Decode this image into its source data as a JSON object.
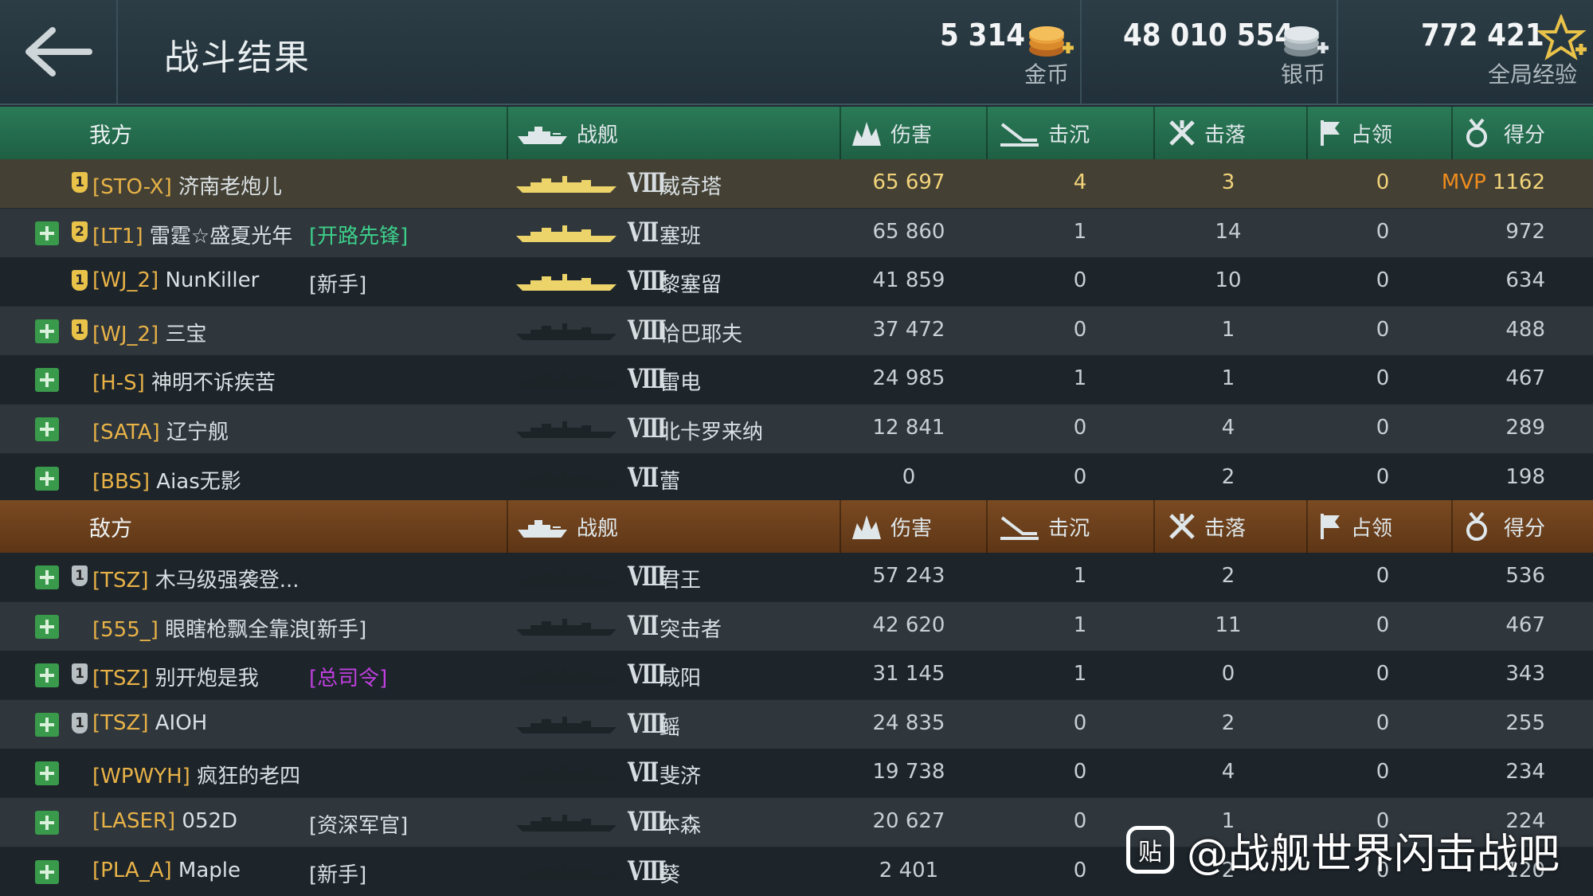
{
  "header": {
    "title": "战斗结果",
    "gold": {
      "amount": "5 314",
      "label": "金币"
    },
    "silver": {
      "amount": "48 010 554",
      "label": "银币"
    },
    "xp": {
      "amount": "772 421",
      "label": "全局经验"
    }
  },
  "columns": {
    "ship": "战舰",
    "damage": "伤害",
    "sunk": "击沉",
    "downed": "击落",
    "captured": "占领",
    "score": "得分"
  },
  "allies": {
    "label": "我方",
    "rows": [
      {
        "badge": "1",
        "clan": "[STO-X]",
        "name": "济南老炮儿",
        "title": "",
        "tier": "VIII",
        "ship": "威奇塔",
        "damage": "65 697",
        "sunk": "4",
        "downed": "3",
        "captured": "0",
        "mvp": "MVP",
        "score": "1162"
      },
      {
        "badge": "2",
        "clan": "[LT1]",
        "name": "雷霆☆盛夏光年",
        "title": "[开路先锋]",
        "tier": "VII",
        "ship": "塞班",
        "damage": "65 860",
        "sunk": "1",
        "downed": "14",
        "captured": "0",
        "mvp": "",
        "score": "972"
      },
      {
        "badge": "1",
        "clan": "[WJ_2]",
        "name": "NunKiller",
        "title": "[新手]",
        "tier": "VIII",
        "ship": "黎塞留",
        "damage": "41 859",
        "sunk": "0",
        "downed": "10",
        "captured": "0",
        "mvp": "",
        "score": "634"
      },
      {
        "badge": "1",
        "clan": "[WJ_2]",
        "name": "三宝",
        "title": "",
        "tier": "VIII",
        "ship": "恰巴耶夫",
        "damage": "37 472",
        "sunk": "0",
        "downed": "1",
        "captured": "0",
        "mvp": "",
        "score": "488"
      },
      {
        "badge": "",
        "clan": "[H-S]",
        "name": "神明不诉疾苦",
        "title": "",
        "tier": "VIII",
        "ship": "雷电",
        "damage": "24 985",
        "sunk": "1",
        "downed": "1",
        "captured": "0",
        "mvp": "",
        "score": "467"
      },
      {
        "badge": "",
        "clan": "[SATA]",
        "name": "辽宁舰",
        "title": "",
        "tier": "VIII",
        "ship": "北卡罗来纳",
        "damage": "12 841",
        "sunk": "0",
        "downed": "4",
        "captured": "0",
        "mvp": "",
        "score": "289"
      },
      {
        "badge": "",
        "clan": "[BBS]",
        "name": "Aias无影",
        "title": "",
        "tier": "VII",
        "ship": "蕾",
        "damage": "0",
        "sunk": "0",
        "downed": "2",
        "captured": "0",
        "mvp": "",
        "score": "198"
      }
    ]
  },
  "enemies": {
    "label": "敌方",
    "rows": [
      {
        "badge": "1",
        "clan": "[TSZ]",
        "name": "木马级强袭登...",
        "title": "",
        "tier": "VIII",
        "ship": "君王",
        "damage": "57 243",
        "sunk": "1",
        "downed": "2",
        "captured": "0",
        "score": "536"
      },
      {
        "badge": "",
        "clan": "[555_]",
        "name": "眼瞎枪飘全靠浪",
        "title": "[新手]",
        "tier": "VII",
        "ship": "突击者",
        "damage": "42 620",
        "sunk": "1",
        "downed": "11",
        "captured": "0",
        "score": "467"
      },
      {
        "badge": "1",
        "clan": "[TSZ]",
        "name": "别开炮是我",
        "title": "[总司令]",
        "tier": "VIII",
        "ship": "咸阳",
        "damage": "31 145",
        "sunk": "1",
        "downed": "0",
        "captured": "0",
        "score": "343"
      },
      {
        "badge": "1",
        "clan": "[TSZ]",
        "name": "AIOH",
        "title": "",
        "tier": "VIII",
        "ship": "鳐",
        "damage": "24 835",
        "sunk": "0",
        "downed": "2",
        "captured": "0",
        "score": "255"
      },
      {
        "badge": "",
        "clan": "[WPWYH]",
        "name": "疯狂的老四",
        "title": "",
        "tier": "VII",
        "ship": "斐济",
        "damage": "19 738",
        "sunk": "0",
        "downed": "4",
        "captured": "0",
        "score": "234"
      },
      {
        "badge": "",
        "clan": "[LASER]",
        "name": "052D",
        "title": "[资深军官]",
        "tier": "VIII",
        "ship": "本森",
        "damage": "20 627",
        "sunk": "0",
        "downed": "1",
        "captured": "0",
        "score": "224"
      },
      {
        "badge": "",
        "clan": "[PLA_A]",
        "name": "Maple",
        "title": "[新手]",
        "tier": "VIII",
        "ship": "葵",
        "damage": "2 401",
        "sunk": "0",
        "downed": "2",
        "captured": "0",
        "score": "120"
      }
    ]
  },
  "watermark": {
    "logo": "贴",
    "text": "@战舰世界闪击战吧"
  },
  "colors": {
    "allies_header": "#1f5f44",
    "enemies_header": "#5e3616",
    "clan_tag": "#e8b247",
    "mvp": "#f08c1e",
    "title_green": "#3ccf8a",
    "title_purple": "#c040e0"
  }
}
